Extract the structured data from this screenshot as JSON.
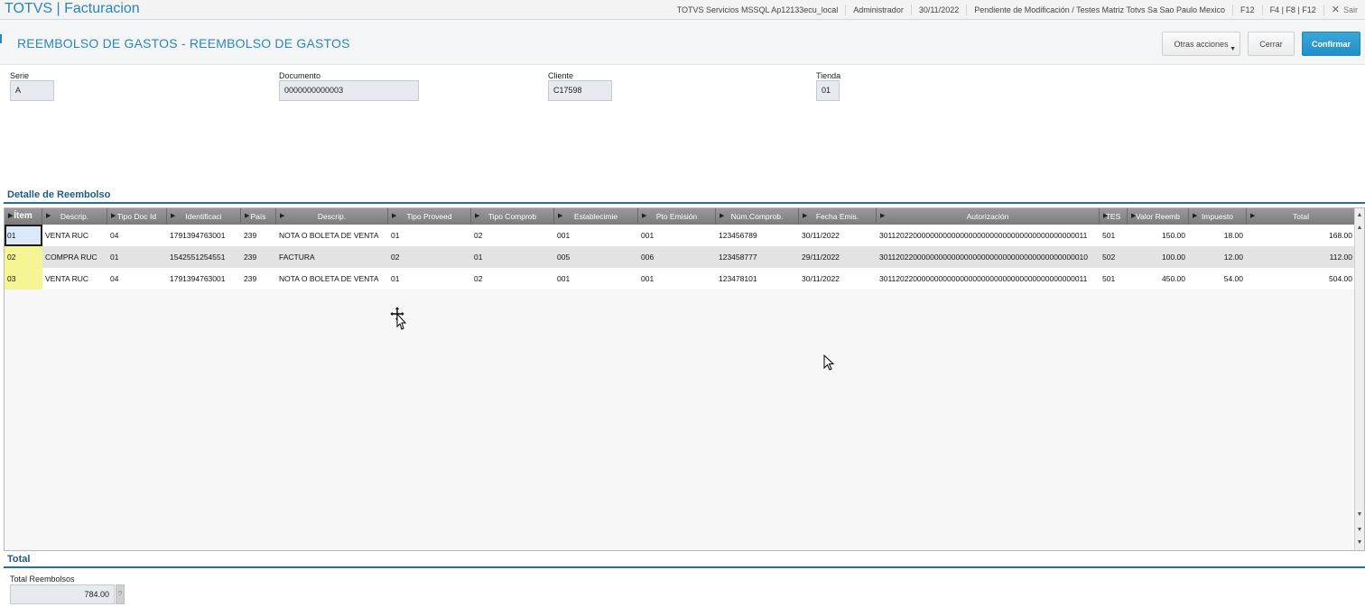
{
  "topbar": {
    "app_title": "TOTVS | Facturacion",
    "server": "TOTVS Servicios MSSQL Ap12133ecu_local",
    "user": "Administrador",
    "date": "30/11/2022",
    "environment": "Pendiente de Modificación / Testes Matriz Totvs Sa Sao Paulo Mexico",
    "shortcut_f12": "F12",
    "shortcuts": "F4 | F8 | F12",
    "exit_label": "Sair"
  },
  "header": {
    "title": "REEMBOLSO DE GASTOS - REEMBOLSO DE GASTOS",
    "other_actions_label": "Otras acciones",
    "close_label": "Cerrar",
    "confirm_label": "Confirmar"
  },
  "fields": {
    "serie": {
      "label": "Serie",
      "value": "A"
    },
    "documento": {
      "label": "Documento",
      "value": "0000000000003"
    },
    "cliente": {
      "label": "Cliente",
      "value": "C17598"
    },
    "tienda": {
      "label": "Tienda",
      "value": "01"
    }
  },
  "detail": {
    "section_title": "Detalle de Reembolso",
    "columns": [
      "Ítem",
      "Descrip.",
      "Tipo Doc Id",
      "Identificaci",
      "País",
      "Descrip.",
      "Tipo Proveed",
      "Tipo Comprob",
      "Establecimie",
      "Pto Emisión",
      "Núm.Comprob.",
      "Fecha Emis.",
      "Autorización",
      "TES",
      "Valor Reemb",
      "Impuesto",
      "Total"
    ],
    "rows": [
      [
        "01",
        "VENTA RUC",
        "04",
        "1791394763001",
        "239",
        "NOTA O BOLETA DE VENTA",
        "01",
        "02",
        "001",
        "001",
        "123456789",
        "30/11/2022",
        "3011202200000000000000000000000000000000000000011",
        "501",
        "150.00",
        "18.00",
        "168.00"
      ],
      [
        "02",
        "COMPRA RUC",
        "01",
        "1542551254551",
        "239",
        "FACTURA",
        "02",
        "01",
        "005",
        "006",
        "123458777",
        "29/11/2022",
        "3011202200000000000000000000000000000000000000010",
        "502",
        "100.00",
        "12.00",
        "112.00"
      ],
      [
        "03",
        "VENTA RUC",
        "04",
        "1791394763001",
        "239",
        "NOTA O BOLETA DE VENTA",
        "01",
        "02",
        "001",
        "001",
        "123478101",
        "30/11/2022",
        "3011202200000000000000000000000000000000000000011",
        "501",
        "450.00",
        "54.00",
        "504.00"
      ]
    ]
  },
  "total": {
    "section_title": "Total",
    "label": "Total Reembolsos",
    "value": "784.00",
    "help": "?"
  },
  "colors": {
    "accent": "#2a86b8",
    "section": "#1d5a84",
    "confirm": "#2a97cc",
    "grid_header": "#8a8a8a",
    "item_highlight": "#f5f594"
  },
  "icons": {
    "exit": "close-icon",
    "dropdown": "caret-down-icon",
    "header_sort": "triangle-right-icon",
    "scroll": "arrow-icons"
  }
}
